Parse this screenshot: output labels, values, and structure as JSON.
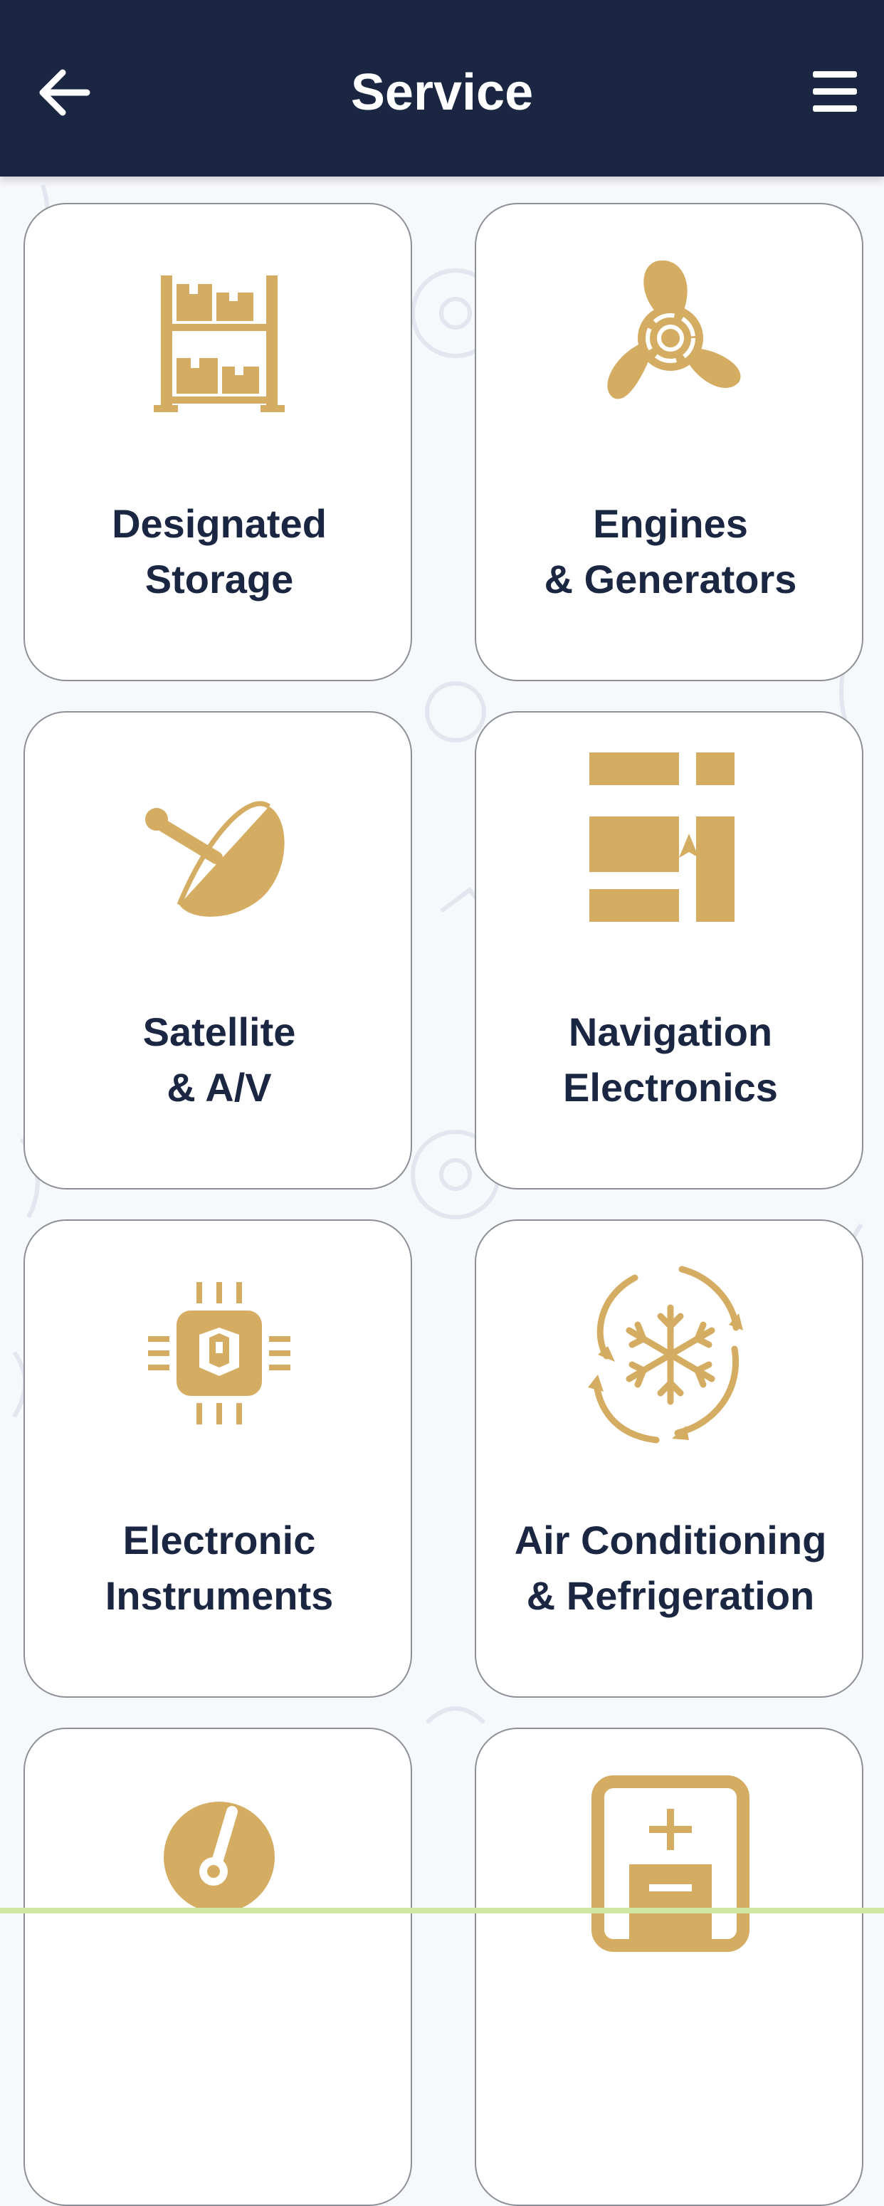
{
  "header": {
    "title": "Service",
    "back_icon": "arrow-left-icon",
    "menu_icon": "hamburger-menu-icon"
  },
  "colors": {
    "header_bg": "#1b2742",
    "accent_gold": "#d4ac62",
    "label_text": "#1b2742",
    "card_bg": "#ffffff"
  },
  "services": [
    {
      "line1": "Designated",
      "line2": "Storage",
      "icon": "storage-shelves-icon"
    },
    {
      "line1": "Engines",
      "line2": "& Generators",
      "icon": "propeller-icon"
    },
    {
      "line1": "Satellite",
      "line2": "& A/V",
      "icon": "satellite-dish-icon"
    },
    {
      "line1": "Navigation",
      "line2": "Electronics",
      "icon": "navigation-chart-icon"
    },
    {
      "line1": "Electronic",
      "line2": "Instruments",
      "icon": "microchip-icon"
    },
    {
      "line1": "Air Conditioning",
      "line2": "& Refrigeration",
      "icon": "snowflake-cycle-icon"
    },
    {
      "line1": "",
      "line2": "",
      "icon": "gauge-icon"
    },
    {
      "line1": "",
      "line2": "",
      "icon": "battery-icon"
    }
  ]
}
